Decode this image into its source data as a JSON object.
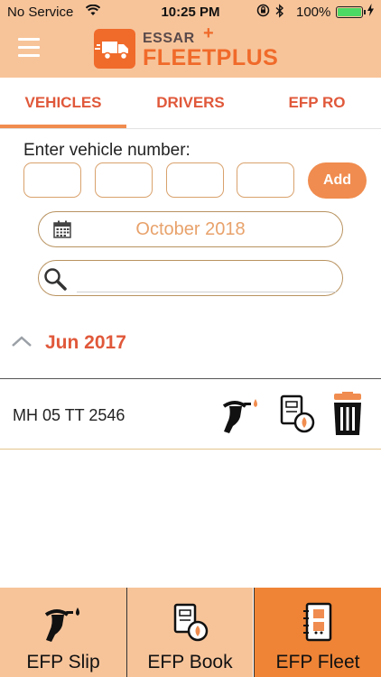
{
  "status_bar": {
    "carrier": "No Service",
    "time": "10:25 PM",
    "battery_percent": "100%",
    "battery_level": 1.0
  },
  "header": {
    "brand_top": "ESSAR",
    "brand_bottom": "FLEETPLUS",
    "brand_plus": "+",
    "background": "#f7c49a",
    "accent": "#f06a2a"
  },
  "tabs": [
    {
      "label": "VEHICLES",
      "active": true
    },
    {
      "label": "DRIVERS",
      "active": false
    },
    {
      "label": "EFP RO",
      "active": false
    }
  ],
  "vehicle_entry": {
    "label": "Enter vehicle number:",
    "fields": [
      "",
      "",
      "",
      ""
    ],
    "add_label": "Add"
  },
  "date_filter": {
    "value": "October 2018"
  },
  "search": {
    "value": "",
    "placeholder": ""
  },
  "group": {
    "month": "Jun 2017",
    "vehicles": [
      {
        "number": "MH 05 TT 2546"
      }
    ]
  },
  "bottom_nav": [
    {
      "label": "EFP Slip",
      "icon": "fuel-nozzle-icon",
      "active": false
    },
    {
      "label": "EFP Book",
      "icon": "book-icon",
      "active": false
    },
    {
      "label": "EFP Fleet",
      "icon": "fleet-book-icon",
      "active": true
    }
  ],
  "colors": {
    "tab_text": "#e0583a",
    "button": "#f08c4f",
    "date_text": "#e8a26b",
    "active_nav": "#ef8436"
  }
}
